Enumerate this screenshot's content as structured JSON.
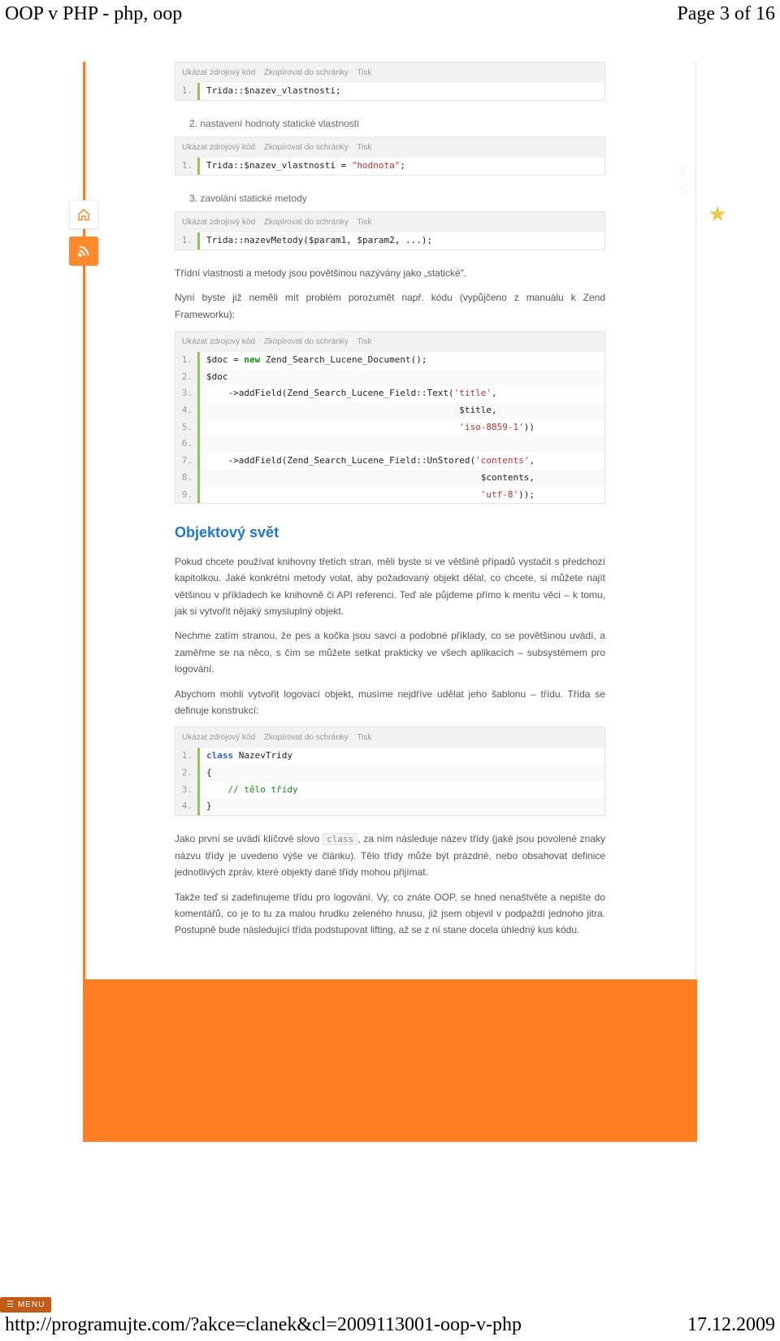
{
  "header": {
    "title": "OOP v PHP - php, oop",
    "page_indicator": "Page 3 of 16"
  },
  "footer": {
    "url": "http://programujte.com/?akce=clanek&cl=2009113001-oop-v-php",
    "date": "17.12.2009"
  },
  "toolbar": {
    "show": "Ukázat zdrojový kód",
    "copy": "Zkopírovat do schránky",
    "print": "Tisk"
  },
  "sidebar": {
    "word": "obsah",
    "menu_label": "MENU"
  },
  "icons": {
    "home": "home-icon",
    "rss": "rss-icon",
    "star": "star-icon",
    "menu": "menu-icon"
  },
  "code_blocks": {
    "b1": {
      "lines": [
        {
          "n": "1.",
          "t": "Trida::$nazev_vlastnosti;"
        }
      ]
    },
    "b2": {
      "lines": [
        {
          "n": "1.",
          "t0": "Trida::$nazev_vlastnosti = ",
          "t1": "\"hodnota\"",
          "t2": ";"
        }
      ]
    },
    "b3": {
      "lines": [
        {
          "n": "1.",
          "t": "Trida::nazevMetody($param1, $param2, ...);"
        }
      ]
    },
    "b4": {
      "lines": [
        {
          "n": "1.",
          "a": "$doc = ",
          "b": "new",
          "c": " Zend_Search_Lucene_Document();"
        },
        {
          "n": "2.",
          "t": "$doc"
        },
        {
          "n": "3.",
          "a": "    ->addField(Zend_Search_Lucene_Field::Text(",
          "s": "'title'",
          "c": ","
        },
        {
          "n": "4.",
          "t": "                                               $title,"
        },
        {
          "n": "5.",
          "a": "                                               ",
          "s": "'iso-8859-1'",
          "c": "))"
        },
        {
          "n": "6.",
          "t": ""
        },
        {
          "n": "7.",
          "a": "    ->addField(Zend_Search_Lucene_Field::UnStored(",
          "s": "'contents'",
          "c": ","
        },
        {
          "n": "8.",
          "t": "                                                   $contents,"
        },
        {
          "n": "9.",
          "a": "                                                   ",
          "s": "'utf-8'",
          "c": "));"
        }
      ]
    },
    "b5": {
      "lines": [
        {
          "n": "1.",
          "a": "class",
          "c": " NazevTridy"
        },
        {
          "n": "2.",
          "t": "{"
        },
        {
          "n": "3.",
          "a": "    ",
          "cm": "// tělo třídy"
        },
        {
          "n": "4.",
          "t": "}"
        }
      ]
    }
  },
  "text": {
    "num2": "2. nastavení hodnoty statické vlastnosti",
    "num3": "3. zavolání statické metody",
    "para_static": "Třídní vlastnosti a metody jsou povětšinou nazývány jako „statické\".",
    "para_zend": "Nyní byste již neměli mít problém porozumět např. kódu (vypůjčeno z manuálu k Zend Frameworku):",
    "heading": "Objektový svět",
    "p1": "Pokud chcete používat knihovny třetích stran, měli byste si ve většině případů vystačit s předchozí kapitolkou. Jaké konkrétní metody volat, aby požadovaný objekt dělal, co chcete, si můžete najít většinou v příkladech ke knihovně či API referenci. Teď ale půjdeme přímo k meritu věci – k tomu, jak si vytvořit nějaký smysluplný objekt.",
    "p2": "Nechme zatím stranou, že pes a kočka jsou savci a podobné příklady, co se povětšinou uvádí,  a  zaměřme se na   něco,   s čím se můžete   setkat   prakticky ve všech   aplikacích – subsystémem pro logování.",
    "p3": "Abychom  mohli  vytvořit  logovací  objekt,  musíme  nejdříve  udělat  jeho  šablonu – třídu. Třída se definuje konstrukcí:",
    "p4a": "Jako  první se uvádí  klíčové  slovo ",
    "class_kw": "class",
    "p4b": ", za ním následuje název třídy (jaké jsou povolené znaky názvu třídy je uvedeno výše ve článku). Tělo třídy může být prázdné, nebo obsahovat definice jednotlivých zpráv, které objekty dané třídy mohou přijímat.",
    "p5": "Takže teď si zadefinujeme třídu pro logování. Vy, co znáte OOP, se hned nenaštvěte a nepište do komentářů, co je to tu za malou hrudku zeleného hnusu, již jsem objevil v podpaždí jednoho jitra. Postupně bude následující třída podstupovat lifting, až se z ní stane docela úhledný kus kódu."
  }
}
